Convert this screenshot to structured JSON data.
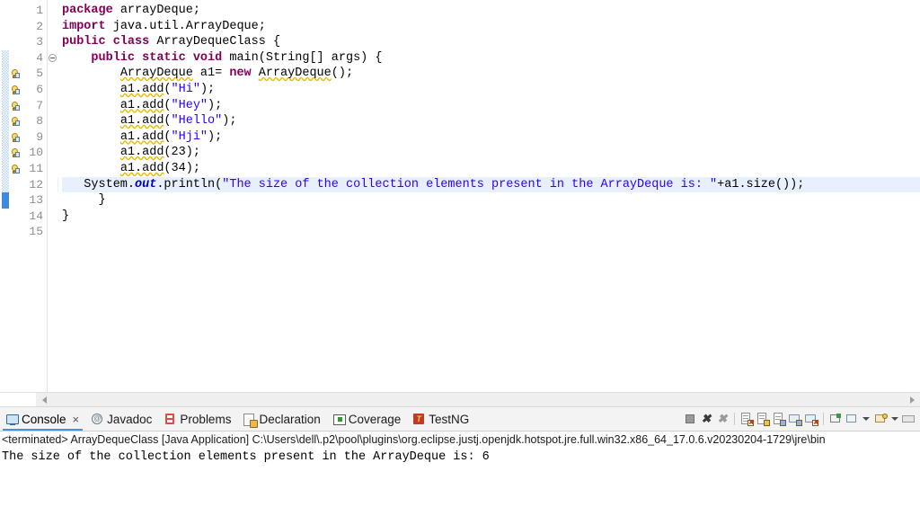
{
  "editor": {
    "lines": [
      {
        "num": "1",
        "fold": false,
        "warn": false,
        "change": "none",
        "highlight": false,
        "tokens": [
          {
            "t": "package ",
            "c": "kw"
          },
          {
            "t": "arrayDeque;",
            "c": "plain"
          }
        ],
        "indent": 0
      },
      {
        "num": "2",
        "fold": false,
        "warn": false,
        "change": "none",
        "highlight": false,
        "tokens": [
          {
            "t": "import ",
            "c": "kw"
          },
          {
            "t": "java.util.ArrayDeque;",
            "c": "plain"
          }
        ],
        "indent": 0
      },
      {
        "num": "3",
        "fold": false,
        "warn": false,
        "change": "none",
        "highlight": false,
        "tokens": [
          {
            "t": "public class ",
            "c": "kw"
          },
          {
            "t": "ArrayDequeClass {",
            "c": "plain"
          }
        ],
        "indent": 0
      },
      {
        "num": "4",
        "fold": true,
        "warn": false,
        "change": "hatch",
        "highlight": false,
        "tokens": [
          {
            "t": "    public static void ",
            "c": "kw"
          },
          {
            "t": "main(String[] args) {",
            "c": "plain"
          }
        ],
        "indent": 0
      },
      {
        "num": "5",
        "fold": false,
        "warn": true,
        "change": "hatch",
        "highlight": false,
        "tokens": [
          {
            "t": "        ",
            "c": "plain"
          },
          {
            "t": "ArrayDeque",
            "c": "squig"
          },
          {
            "t": " a1= ",
            "c": "plain"
          },
          {
            "t": "new ",
            "c": "kw"
          },
          {
            "t": "ArrayDeque",
            "c": "squig"
          },
          {
            "t": "();",
            "c": "plain"
          }
        ],
        "indent": 0
      },
      {
        "num": "6",
        "fold": false,
        "warn": true,
        "change": "hatch",
        "highlight": false,
        "tokens": [
          {
            "t": "        ",
            "c": "plain"
          },
          {
            "t": "a1.add",
            "c": "squig"
          },
          {
            "t": "(",
            "c": "plain"
          },
          {
            "t": "\"Hi\"",
            "c": "str"
          },
          {
            "t": ");",
            "c": "plain"
          }
        ],
        "indent": 0
      },
      {
        "num": "7",
        "fold": false,
        "warn": true,
        "change": "hatch",
        "highlight": false,
        "tokens": [
          {
            "t": "        ",
            "c": "plain"
          },
          {
            "t": "a1.add",
            "c": "squig"
          },
          {
            "t": "(",
            "c": "plain"
          },
          {
            "t": "\"Hey\"",
            "c": "str"
          },
          {
            "t": ");",
            "c": "plain"
          }
        ],
        "indent": 0
      },
      {
        "num": "8",
        "fold": false,
        "warn": true,
        "change": "hatch",
        "highlight": false,
        "tokens": [
          {
            "t": "        ",
            "c": "plain"
          },
          {
            "t": "a1.add",
            "c": "squig"
          },
          {
            "t": "(",
            "c": "plain"
          },
          {
            "t": "\"Hello\"",
            "c": "str"
          },
          {
            "t": ");",
            "c": "plain"
          }
        ],
        "indent": 0
      },
      {
        "num": "9",
        "fold": false,
        "warn": true,
        "change": "hatch",
        "highlight": false,
        "tokens": [
          {
            "t": "        ",
            "c": "plain"
          },
          {
            "t": "a1.add",
            "c": "squig"
          },
          {
            "t": "(",
            "c": "plain"
          },
          {
            "t": "\"Hji\"",
            "c": "str"
          },
          {
            "t": ");",
            "c": "plain"
          }
        ],
        "indent": 0
      },
      {
        "num": "10",
        "fold": false,
        "warn": true,
        "change": "hatch",
        "highlight": false,
        "tokens": [
          {
            "t": "        ",
            "c": "plain"
          },
          {
            "t": "a1.add",
            "c": "squig"
          },
          {
            "t": "(23);",
            "c": "plain"
          }
        ],
        "indent": 0
      },
      {
        "num": "11",
        "fold": false,
        "warn": true,
        "change": "hatch",
        "highlight": false,
        "tokens": [
          {
            "t": "        ",
            "c": "plain"
          },
          {
            "t": "a1.add",
            "c": "squig"
          },
          {
            "t": "(34);",
            "c": "plain"
          }
        ],
        "indent": 0
      },
      {
        "num": "12",
        "fold": false,
        "warn": false,
        "change": "hatch",
        "highlight": true,
        "tokens": [
          {
            "t": "   System.",
            "c": "plain"
          },
          {
            "t": "out",
            "c": "fld"
          },
          {
            "t": ".println(",
            "c": "plain"
          },
          {
            "t": "\"The size of the collection elements present in the ArrayDeque is: \"",
            "c": "str"
          },
          {
            "t": "+a1.size());",
            "c": "plain"
          }
        ],
        "indent": 0
      },
      {
        "num": "13",
        "fold": false,
        "warn": false,
        "change": "solid",
        "highlight": false,
        "tokens": [
          {
            "t": "     }",
            "c": "plain"
          }
        ],
        "indent": 0
      },
      {
        "num": "14",
        "fold": false,
        "warn": false,
        "change": "none",
        "highlight": false,
        "tokens": [
          {
            "t": "}",
            "c": "plain"
          }
        ],
        "indent": 0
      },
      {
        "num": "15",
        "fold": false,
        "warn": false,
        "change": "none",
        "highlight": false,
        "tokens": [
          {
            "t": "",
            "c": "plain"
          }
        ],
        "indent": 0
      }
    ]
  },
  "console": {
    "tabs": [
      {
        "label": "Console",
        "icon": "console-icon",
        "active": true,
        "closable": true,
        "close_glyph": "×"
      },
      {
        "label": "Javadoc",
        "icon": "javadoc-icon",
        "active": false,
        "closable": false,
        "close_glyph": ""
      },
      {
        "label": "Problems",
        "icon": "problems-icon",
        "active": false,
        "closable": false,
        "close_glyph": ""
      },
      {
        "label": "Declaration",
        "icon": "declaration-icon",
        "active": false,
        "closable": false,
        "close_glyph": ""
      },
      {
        "label": "Coverage",
        "icon": "coverage-icon",
        "active": false,
        "closable": false,
        "close_glyph": ""
      },
      {
        "label": "TestNG",
        "icon": "testng-icon",
        "active": false,
        "closable": false,
        "close_glyph": "T"
      }
    ],
    "toolbar": [
      {
        "name": "terminate-button"
      },
      {
        "name": "remove-launch-button"
      },
      {
        "name": "remove-all-terminated-button"
      },
      {
        "name": "separator-1"
      },
      {
        "name": "clear-console-button"
      },
      {
        "name": "scroll-lock-button"
      },
      {
        "name": "word-wrap-button"
      },
      {
        "name": "show-console-button"
      },
      {
        "name": "close-console-button"
      },
      {
        "name": "separator-2"
      },
      {
        "name": "pin-console-button"
      },
      {
        "name": "display-selected-console-button"
      },
      {
        "name": "display-selected-console-dropdown"
      },
      {
        "name": "open-console-button"
      },
      {
        "name": "open-console-dropdown"
      },
      {
        "name": "view-menu-button"
      }
    ],
    "launch_line": "<terminated> ArrayDequeClass [Java Application] C:\\Users\\dell\\.p2\\pool\\plugins\\org.eclipse.justj.openjdk.hotspot.jre.full.win32.x86_64_17.0.6.v20230204-1729\\jre\\bin",
    "output": [
      "The size of the collection elements present in the ArrayDeque is: 6"
    ]
  },
  "colors": {
    "keyword": "#7f0055",
    "string": "#2a00ff",
    "field": "#0000c0",
    "warning_squiggle": "#e8b800",
    "highlight_line": "#e8f0fe",
    "change_bar": "#3d8ae0",
    "tab_accent": "#4a90d9"
  }
}
